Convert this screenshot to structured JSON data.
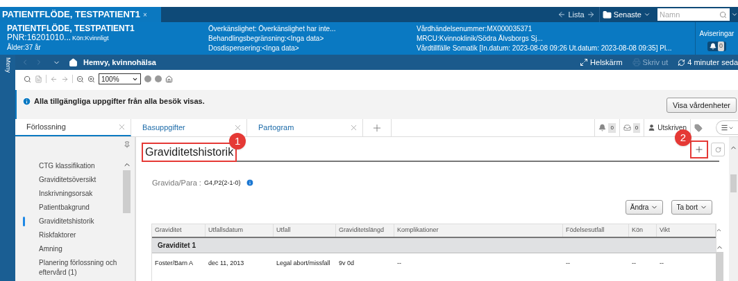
{
  "window_tab": {
    "title": "PATIENTFLÖDE, TESTPATIENT1",
    "close": "×"
  },
  "top_nav": {
    "list_label": "Lista",
    "recent_label": "Senaste",
    "search": {
      "placeholder": "Namn"
    }
  },
  "patient_header": {
    "name": "PATIENTFLÖDE, TESTPATIENT1",
    "pnr": "PNR:16201010...",
    "gender": "Kön:Kvinnligt",
    "age": "Ålder:37 år",
    "column_2": [
      "Överkänslighet: Överkänslighet har inte...",
      "Behandlingsbegränsning:<Inga data>",
      "Dosdispensering:<Inga data>"
    ],
    "column_3": [
      "Vårdhändelsenummer:MX000035371",
      "MRCU:Kvinnoklinik/Södra Älvsborgs Sj...",
      "Vårdtillfälle Somatik [In.datum: 2023-08-08 09:26 Ut.datum: 2023-08-08 09:35] Pl..."
    ],
    "notifications": {
      "label": "Aviseringar",
      "count": "0"
    }
  },
  "menu_strip": {
    "label": "Meny"
  },
  "nav_bar": {
    "title": "Hemvy, kvinnohälsa",
    "fullscreen": "Helskärm",
    "print": {
      "label": "Skriv ut",
      "disabled": true
    },
    "refresh": "4 minuter seda"
  },
  "toolbar": {
    "zoom": "100%"
  },
  "info_banner": {
    "text": "Alla tillgängliga uppgifter från alla besök visas.",
    "button": "Visa vårdenheter"
  },
  "tabs": [
    {
      "label": "Förlossning",
      "selected": true
    },
    {
      "label": "Basuppgifter",
      "selected": false
    },
    {
      "label": "Partogram",
      "selected": false
    }
  ],
  "tab_status": {
    "bell_count": "0",
    "inbox_count": "0",
    "status": "Utskriven"
  },
  "sidebar": {
    "items": [
      {
        "label": "CTG klassifikation",
        "selected": false
      },
      {
        "label": "Graviditetsöversikt",
        "selected": false
      },
      {
        "label": "Inskrivningsorsak",
        "selected": false
      },
      {
        "label": "Patientbakgrund",
        "selected": false
      },
      {
        "label": "Graviditetshistorik",
        "selected": true
      },
      {
        "label": "Riskfaktorer",
        "selected": false
      },
      {
        "label": "Amning",
        "selected": false
      },
      {
        "label": "Planering förlossning och eftervård (1)",
        "selected": false
      }
    ]
  },
  "section": {
    "title": "Graviditetshistorik",
    "gravida_label": "Gravida/Para :",
    "gravida_value": "G4,P2(2-1-0)",
    "buttons": [
      "Ändra",
      "Ta bort"
    ]
  },
  "callouts": [
    "1",
    "2"
  ],
  "table": {
    "columns": [
      "Graviditet",
      "Utfallsdatum",
      "Utfall",
      "Graviditetslängd",
      "Komplikationer",
      "Födelsesutfall",
      "Kön",
      "Vikt"
    ],
    "groups": [
      {
        "title": "Graviditet 1",
        "rows": [
          [
            "Foster/Barn A",
            "dec 11, 2013",
            "Legal abort/missfall",
            "9v 0d",
            "--",
            "--",
            "--",
            "--"
          ]
        ]
      }
    ]
  }
}
